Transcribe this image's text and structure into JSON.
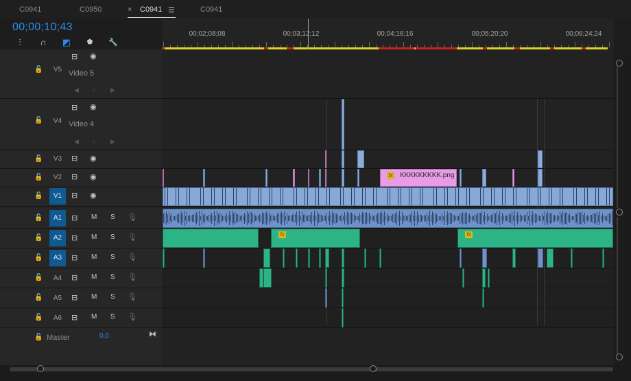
{
  "tabs": [
    {
      "label": "C0941",
      "active": false,
      "closable": false
    },
    {
      "label": "C0950",
      "active": false,
      "closable": false
    },
    {
      "label": "C0941",
      "active": true,
      "closable": true
    },
    {
      "label": "C0941",
      "active": false,
      "closable": false
    }
  ],
  "close_glyph": "×",
  "menu_glyph": "☰",
  "timecode": "00;00;10;43",
  "ruler": {
    "labels": [
      "00;02;08;08",
      "00;03;12;12",
      "00;04;16;16",
      "00;05;20;20",
      "00;06;24;24"
    ]
  },
  "tools": [
    {
      "name": "insert-tool-icon",
      "glyph": "⫶",
      "active": false
    },
    {
      "name": "snap-icon",
      "glyph": "∩",
      "active": false
    },
    {
      "name": "linked-selection-icon",
      "glyph": "◩",
      "active": true
    },
    {
      "name": "add-marker-icon",
      "glyph": "⬟",
      "active": false
    },
    {
      "name": "wrench-icon",
      "glyph": "🔧",
      "active": false
    }
  ],
  "video_tracks": [
    {
      "id": "V5",
      "name": "Video 5",
      "selected": false
    },
    {
      "id": "V4",
      "name": "Video 4",
      "selected": false
    },
    {
      "id": "V3",
      "name": "",
      "selected": false
    },
    {
      "id": "V2",
      "name": "",
      "selected": false
    },
    {
      "id": "V1",
      "name": "",
      "selected": true
    }
  ],
  "audio_tracks": [
    {
      "id": "A1",
      "selected": true,
      "m": "M",
      "s": "S"
    },
    {
      "id": "A2",
      "selected": true,
      "m": "M",
      "s": "S"
    },
    {
      "id": "A3",
      "selected": true,
      "m": "M",
      "s": "S"
    },
    {
      "id": "A4",
      "selected": false,
      "m": "M",
      "s": "S"
    },
    {
      "id": "A5",
      "selected": false,
      "m": "M",
      "s": "S"
    },
    {
      "id": "A6",
      "selected": false,
      "m": "M",
      "s": "S"
    }
  ],
  "master": {
    "label": "Master",
    "value": "0,0"
  },
  "clip_v2_name": "KKKKKKKKK.png",
  "fx_label": "fx",
  "icons": {
    "lock": "🔓",
    "film": "⊟",
    "eye": "◉",
    "mic": "🎙",
    "nav_left": "◀",
    "nav_dot": "○",
    "nav_right": "▶",
    "fit": "⧓"
  },
  "colors": {
    "accent": "#2d8ceb",
    "selected_track": "#0f5a91",
    "video_clip": "#8aaedc",
    "audio_clip": "#2db486",
    "pink_clip": "#e89be6",
    "ruler_yellow": "#dcd22a",
    "ruler_red": "#c8231f"
  }
}
